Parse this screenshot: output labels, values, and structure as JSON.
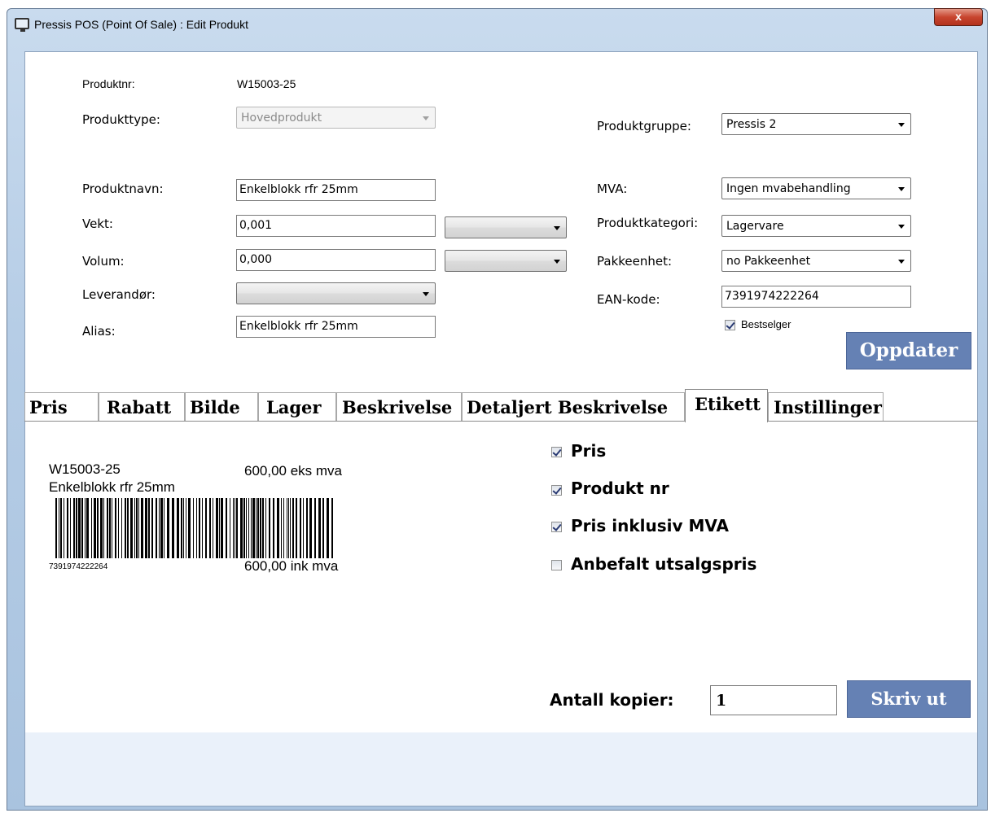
{
  "window": {
    "title": "Pressis POS (Point Of Sale) : Edit Produkt",
    "close_label": "x"
  },
  "form": {
    "produktnr_label": "Produktnr:",
    "produktnr_value": "W15003-25",
    "produkttype_label": "Produkttype:",
    "produkttype_value": "Hovedprodukt",
    "produktgruppe_label": "Produktgruppe:",
    "produktgruppe_value": "Pressis 2",
    "produktnavn_label": "Produktnavn:",
    "produktnavn_value": "Enkelblokk rfr 25mm",
    "mva_label": "MVA:",
    "mva_value": "Ingen mvabehandling",
    "vekt_label": "Vekt:",
    "vekt_value": "0,001",
    "vekt_unit_value": "",
    "produktkategori_label": "Produktkategori:",
    "produktkategori_value": "Lagervare",
    "volum_label": "Volum:",
    "volum_value": "0,000",
    "volum_unit_value": "",
    "pakkeenhet_label": "Pakkeenhet:",
    "pakkeenhet_value": "no Pakkeenhet",
    "leverandor_label": "Leverandør:",
    "leverandor_value": "",
    "ean_label": "EAN-kode:",
    "ean_value": "7391974222264",
    "alias_label": "Alias:",
    "alias_value": "Enkelblokk rfr 25mm",
    "bestselger_label": "Bestselger",
    "bestselger_checked": true,
    "oppdater_label": "Oppdater"
  },
  "tabs": [
    {
      "label": "Pris"
    },
    {
      "label": "Rabatt"
    },
    {
      "label": "Bilde"
    },
    {
      "label": "Lager"
    },
    {
      "label": "Beskrivelse"
    },
    {
      "label": "Detaljert Beskrivelse"
    },
    {
      "label": "Etikett",
      "active": true
    },
    {
      "label": "Instillinger"
    }
  ],
  "etikett": {
    "label_preview": {
      "produktnr": "W15003-25",
      "price_ex": "600,00 eks mva",
      "name": "Enkelblokk rfr 25mm",
      "ean": "7391974222264",
      "price_inc": "600,00 ink mva"
    },
    "options": [
      {
        "label": "Pris",
        "checked": true
      },
      {
        "label": "Produkt nr",
        "checked": true
      },
      {
        "label": "Pris inklusiv MVA",
        "checked": true
      },
      {
        "label": "Anbefalt utsalgspris",
        "checked": false
      }
    ],
    "antall_kopier_label": "Antall kopier:",
    "antall_kopier_value": "1",
    "skriv_ut_label": "Skriv ut"
  }
}
